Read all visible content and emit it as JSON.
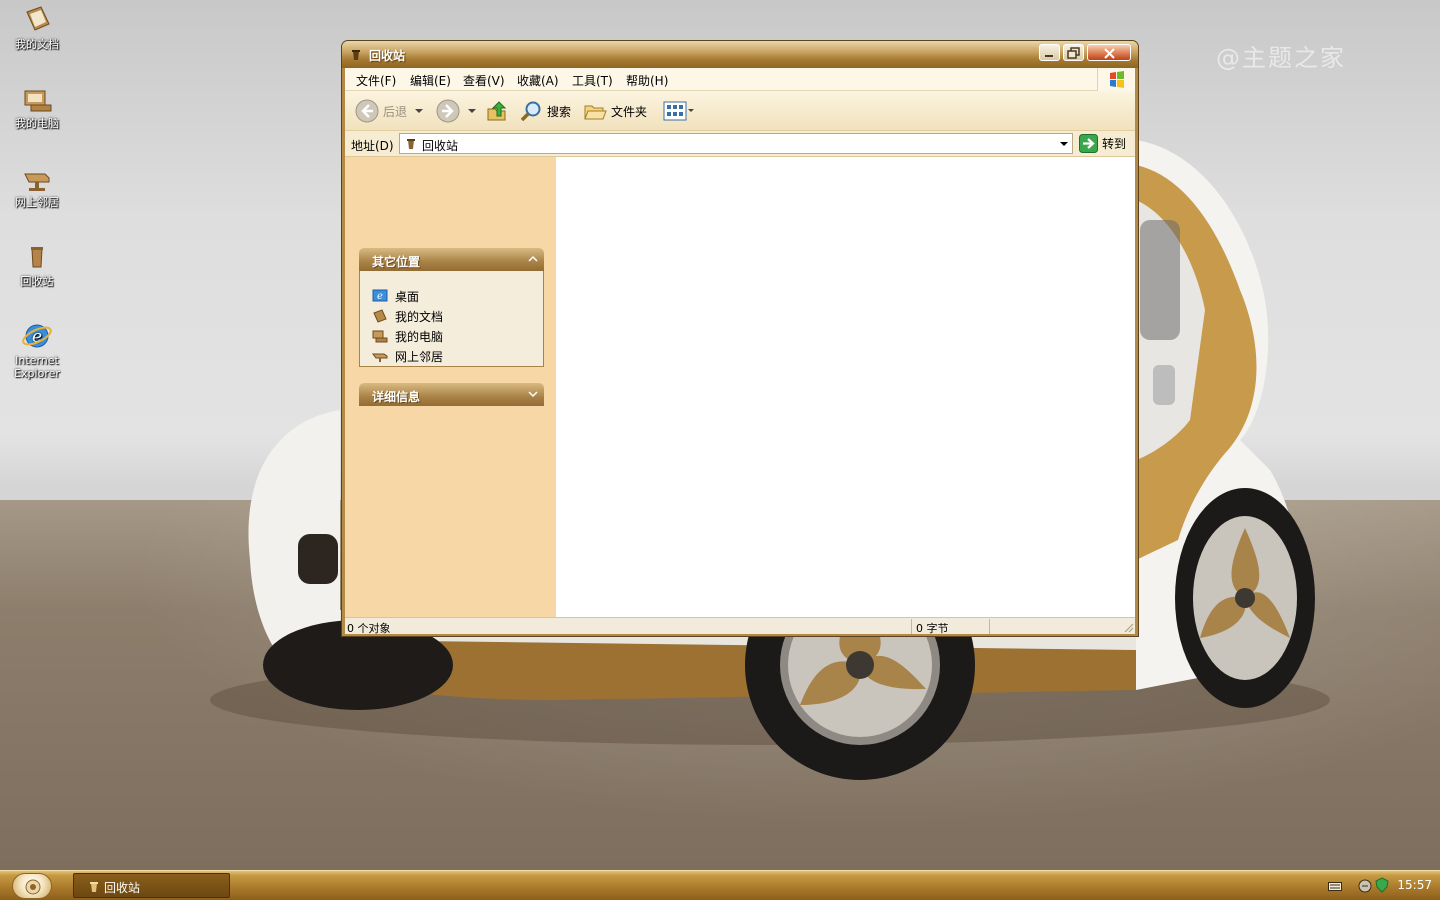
{
  "desktop": {
    "watermark": "@主题之家",
    "icons": [
      {
        "label": "我的文档",
        "icon": "my-documents-icon"
      },
      {
        "label": "我的电脑",
        "icon": "my-computer-icon"
      },
      {
        "label": "网上邻居",
        "icon": "network-places-icon"
      },
      {
        "label": "回收站",
        "icon": "recycle-bin-icon"
      },
      {
        "label": "Internet Explorer",
        "icon": "internet-explorer-icon"
      }
    ]
  },
  "window": {
    "title": "回收站",
    "menu": [
      "文件(F)",
      "编辑(E)",
      "查看(V)",
      "收藏(A)",
      "工具(T)",
      "帮助(H)"
    ],
    "toolbar": {
      "back": "后退",
      "search": "搜索",
      "folders": "文件夹"
    },
    "address": {
      "label": "地址(D)",
      "value": "回收站",
      "go": "转到"
    },
    "taskpane": {
      "other_places": {
        "title": "其它位置",
        "items": [
          "桌面",
          "我的文档",
          "我的电脑",
          "网上邻居"
        ]
      },
      "details": {
        "title": "详细信息"
      }
    },
    "status": {
      "objects": "0 个对象",
      "size": "0 字节"
    }
  },
  "taskbar": {
    "task": "回收站",
    "clock": "15:57"
  },
  "colors": {
    "accent": "#a57930",
    "taskpane": "#f8d7a7",
    "taskbar": "#a8782a"
  }
}
